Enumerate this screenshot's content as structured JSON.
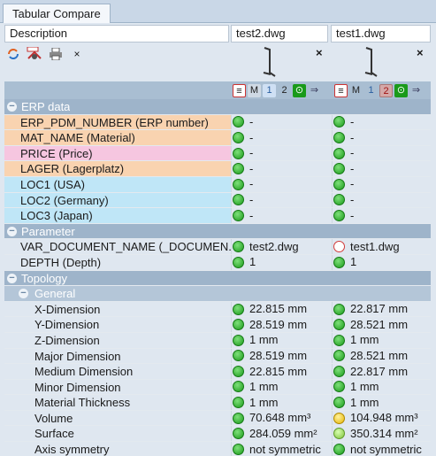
{
  "tab": {
    "title": "Tabular Compare"
  },
  "header": {
    "description": "Description",
    "file1": "test2.dwg",
    "file2": "test1.dwg"
  },
  "toolbar": {
    "icons": [
      "refresh-icon",
      "cad-icon",
      "print-icon",
      "close-icon"
    ],
    "close_glyph": "×"
  },
  "columns": {
    "close_glyph": "×",
    "controls": {
      "m": "M",
      "one": "1",
      "two": "2"
    }
  },
  "sections": {
    "erp": "ERP data",
    "parameter": "Parameter",
    "topology": "Topology",
    "general": "General"
  },
  "rows": {
    "erp": [
      {
        "label": "ERP_PDM_NUMBER (ERP number)",
        "v1": "-",
        "v2": "-",
        "bg": "#f9d3b0"
      },
      {
        "label": "MAT_NAME (Material)",
        "v1": "-",
        "v2": "-",
        "bg": "#f9d3b0"
      },
      {
        "label": "PRICE (Price)",
        "v1": "-",
        "v2": "-",
        "bg": "#f6c6e0"
      },
      {
        "label": "LAGER (Lagerplatz)",
        "v1": "-",
        "v2": "-",
        "bg": "#f9d3b0"
      },
      {
        "label": "LOC1 (USA)",
        "v1": "-",
        "v2": "-",
        "bg": "#bfe6f7"
      },
      {
        "label": "LOC2 (Germany)",
        "v1": "-",
        "v2": "-",
        "bg": "#bfe6f7"
      },
      {
        "label": "LOC3 (Japan)",
        "v1": "-",
        "v2": "-",
        "bg": "#bfe6f7"
      }
    ],
    "parameter": [
      {
        "label": "VAR_DOCUMENT_NAME (_DOCUMEN...",
        "v1": "test2.dwg",
        "v2": "test1.dwg",
        "s1": "green",
        "s2": "red"
      },
      {
        "label": "DEPTH (Depth)",
        "v1": "1",
        "v2": "1",
        "s1": "green",
        "s2": "green"
      }
    ],
    "general": [
      {
        "label": "X-Dimension",
        "v1": "22.815 mm",
        "v2": "22.817 mm",
        "s1": "green",
        "s2": "green"
      },
      {
        "label": "Y-Dimension",
        "v1": "28.519 mm",
        "v2": "28.521 mm",
        "s1": "green",
        "s2": "green"
      },
      {
        "label": "Z-Dimension",
        "v1": "1 mm",
        "v2": "1 mm",
        "s1": "green",
        "s2": "green"
      },
      {
        "label": "Major Dimension",
        "v1": "28.519 mm",
        "v2": "28.521 mm",
        "s1": "green",
        "s2": "green"
      },
      {
        "label": "Medium Dimension",
        "v1": "22.815 mm",
        "v2": "22.817 mm",
        "s1": "green",
        "s2": "green"
      },
      {
        "label": "Minor Dimension",
        "v1": "1 mm",
        "v2": "1 mm",
        "s1": "green",
        "s2": "green"
      },
      {
        "label": "Material Thickness",
        "v1": "1 mm",
        "v2": "1 mm",
        "s1": "green",
        "s2": "green"
      },
      {
        "label": "Volume",
        "v1": "70.648 mm³",
        "v2": "104.948 mm³",
        "s1": "green",
        "s2": "yellow"
      },
      {
        "label": "Surface",
        "v1": "284.059 mm²",
        "v2": "350.314 mm²",
        "s1": "green",
        "s2": "lightgreen"
      },
      {
        "label": "Axis symmetry",
        "v1": "not symmetric",
        "v2": "not symmetric",
        "s1": "green",
        "s2": "green"
      }
    ]
  },
  "colors": {
    "section_bg": "#9eb4ca",
    "subsection_bg": "#b4c6d8",
    "status_green": "#1a9a1a",
    "status_red": "#d23a3a",
    "status_yellow": "#e6b400"
  }
}
